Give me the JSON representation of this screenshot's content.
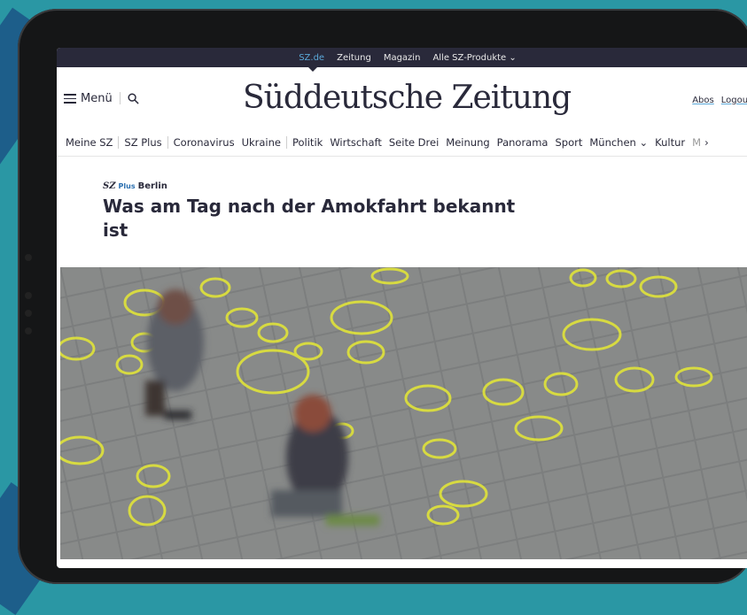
{
  "topbar": {
    "links": [
      "SZ.de",
      "Zeitung",
      "Magazin",
      "Alle SZ-Produkte"
    ],
    "dropdown_icon": "chevron-down-icon"
  },
  "header": {
    "menu_label": "Menü",
    "logo": "Süddeutsche Zeitung",
    "abos": "Abos",
    "logout": "Logout"
  },
  "nav": {
    "items": [
      "Meine SZ",
      "SZ Plus",
      "Coronavirus",
      "Ukraine",
      "Politik",
      "Wirtschaft",
      "Seite Drei",
      "Meinung",
      "Panorama",
      "Sport",
      "München",
      "Kultur",
      "M"
    ]
  },
  "article": {
    "kicker_sz": "SZ",
    "kicker_plus": "Plus",
    "kicker_section": "Berlin",
    "headline": "Was am Tag nach der Amokfahrt bekannt ist"
  },
  "colors": {
    "background": "#2a97a4",
    "topbar": "#29293a",
    "chalk": "#e0e33a"
  }
}
